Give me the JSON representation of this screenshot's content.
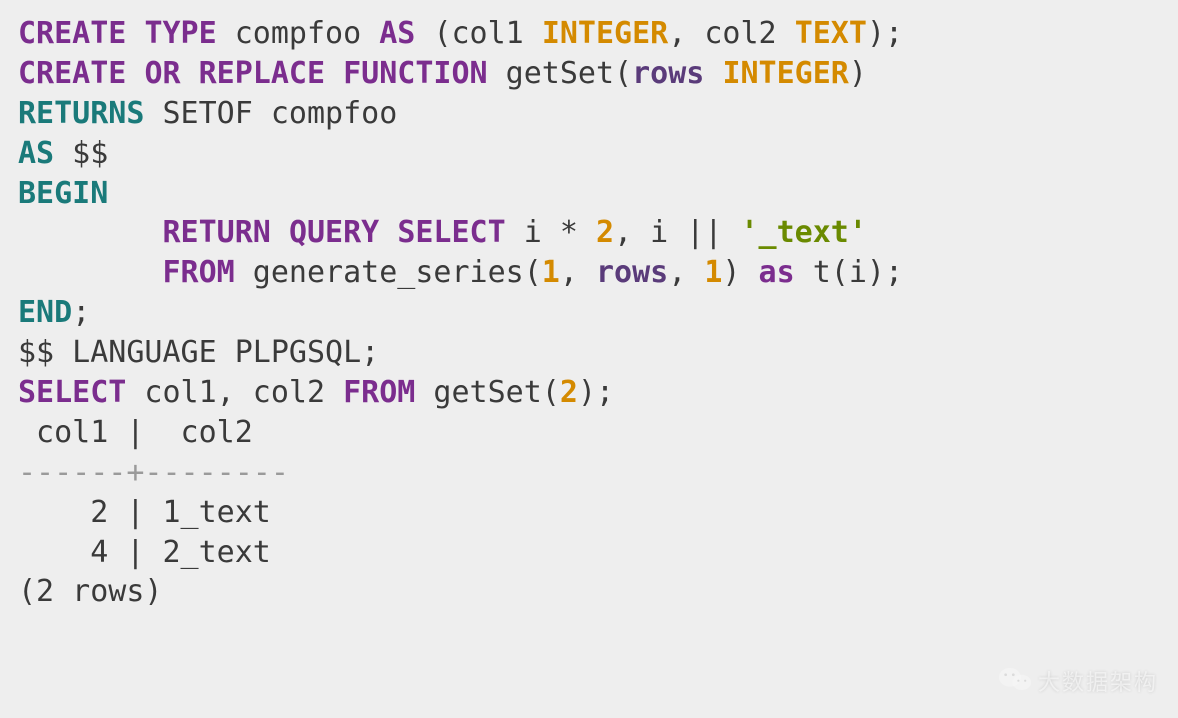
{
  "code": {
    "line1": {
      "create": "CREATE",
      "type_kw": "TYPE",
      "name": "compfoo",
      "as": "AS",
      "open": "(col1 ",
      "int": "INTEGER",
      "sep": ", col2 ",
      "text": "TEXT",
      "close": ");"
    },
    "line2": {
      "create": "CREATE",
      "or": "OR",
      "replace": "REPLACE",
      "function": "FUNCTION",
      "name": " getSet(",
      "rows": "rows",
      "space": " ",
      "int": "INTEGER",
      "close": ")"
    },
    "line3": {
      "returns": "RETURNS",
      "rest": " SETOF compfoo"
    },
    "line4": {
      "as": "AS",
      "dollars": " $$"
    },
    "line5": {
      "begin": "BEGIN"
    },
    "line6": {
      "indent": "        ",
      "return": "RETURN",
      "query": "QUERY",
      "select": "SELECT",
      "expr1": " i * ",
      "two": "2",
      "expr2": ", i || ",
      "str": "'_text'"
    },
    "line7": {
      "indent": "        ",
      "from": "FROM",
      "func": " generate_series(",
      "one": "1",
      "c1": ", ",
      "rows": "rows",
      "c2": ", ",
      "one2": "1",
      "close": ") ",
      "as": "as",
      "tail": " t(i);"
    },
    "line8": {
      "end": "END",
      "semi": ";"
    },
    "line9": {
      "text": "$$ LANGUAGE PLPGSQL;"
    },
    "line10": {
      "select": "SELECT",
      "cols": " col1, col2 ",
      "from": "FROM",
      "call": " getSet(",
      "two": "2",
      "close": ");"
    }
  },
  "output": {
    "header": " col1 |  col2",
    "divider": "------+--------",
    "row1": "    2 | 1_text",
    "row2": "    4 | 2_text",
    "footer": "(2 rows)"
  },
  "watermark": {
    "text": "大数据架构"
  }
}
